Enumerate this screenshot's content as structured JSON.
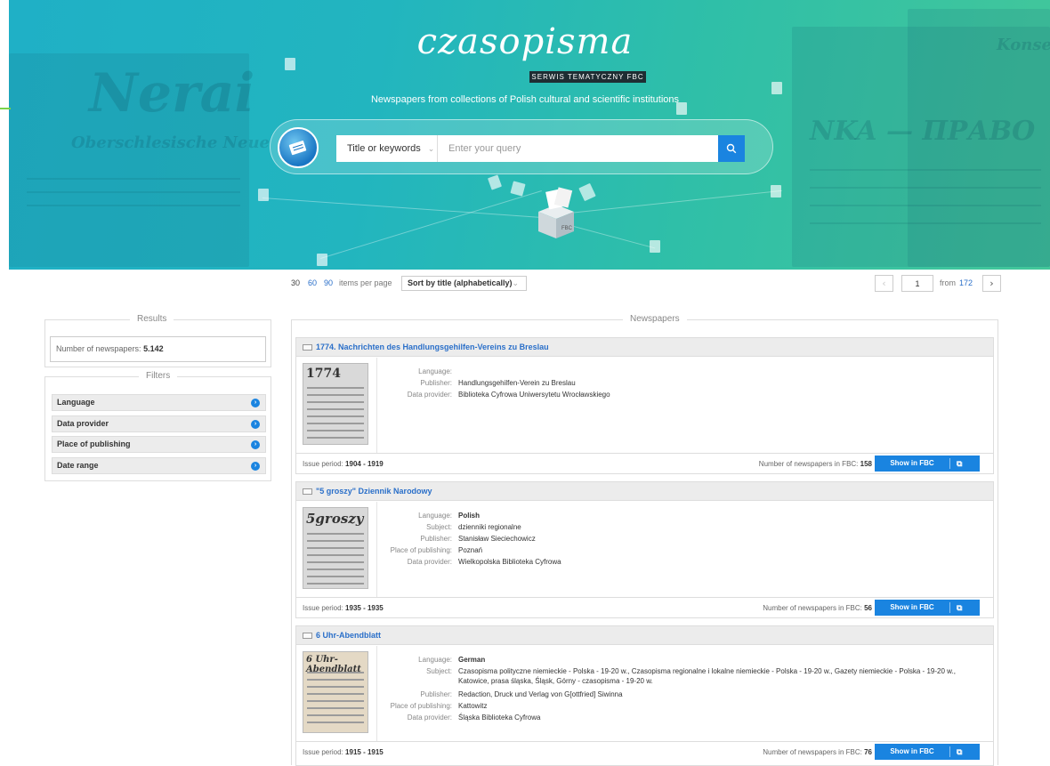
{
  "hero": {
    "logo": "czasopisma",
    "badge": "SERWIS TEMATYCZNY FBC",
    "tagline": "Newspapers from collections of Polish cultural and scientific institutions",
    "search": {
      "scope": "Title or keywords",
      "placeholder": "Enter your query"
    }
  },
  "toolbar": {
    "per_page_options": [
      "30",
      "60",
      "90"
    ],
    "per_page_label": "items per page",
    "sort_value": "Sort by title (alphabetically)",
    "pagination": {
      "current": "1",
      "from_label": "from",
      "total_pages": "172"
    }
  },
  "sidebar": {
    "results_title": "Results",
    "results_label": "Number of newspapers:",
    "results_count": "5.142",
    "filters_title": "Filters",
    "filters": [
      "Language",
      "Data provider",
      "Place of publishing",
      "Date range"
    ]
  },
  "newspapers": {
    "title": "Newspapers",
    "labels": {
      "language": "Language:",
      "subject": "Subject:",
      "publisher": "Publisher:",
      "place": "Place of publishing:",
      "provider": "Data provider:",
      "issue_period": "Issue period:",
      "count": "Number of newspapers in FBC:",
      "show_btn": "Show in FBC"
    },
    "items": [
      {
        "title": "1774. Nachrichten des Handlungsgehilfen-Vereins zu Breslau",
        "thumb_title": "1774",
        "language": "",
        "publisher": "Handlungsgehilfen-Verein zu Breslau",
        "provider": "Biblioteka Cyfrowa Uniwersytetu Wrocławskiego",
        "period": "1904 - 1919",
        "count": "158"
      },
      {
        "title": "\"5 groszy\" Dziennik Narodowy",
        "thumb_title": "5groszy",
        "language": "Polish",
        "subject": "dzienniki regionalne",
        "publisher": "Stanisław Sieciechowicz",
        "place": "Poznań",
        "provider": "Wielkopolska Biblioteka Cyfrowa",
        "period": "1935 - 1935",
        "count": "56"
      },
      {
        "title": "6 Uhr-Abendblatt",
        "thumb_title": "6 Uhr-Abendblatt",
        "language": "German",
        "subject": "Czasopisma polityczne niemieckie - Polska - 19-20 w., Czasopisma regionalne i lokalne niemieckie - Polska - 19-20 w., Gazety niemieckie - Polska - 19-20 w., Katowice, prasa śląska, Śląsk, Górny - czasopisma - 19-20 w.",
        "publisher": "Redaction, Druck und Verlag von G[ottfried] Siwinna",
        "place": "Kattowitz",
        "provider": "Śląska Biblioteka Cyfrowa",
        "period": "1915 - 1915",
        "count": "76"
      }
    ]
  },
  "colors": {
    "accent": "#1a84e0",
    "link": "#2a6fc9",
    "hero_start": "#1fb0c6",
    "hero_end": "#43c79a"
  }
}
